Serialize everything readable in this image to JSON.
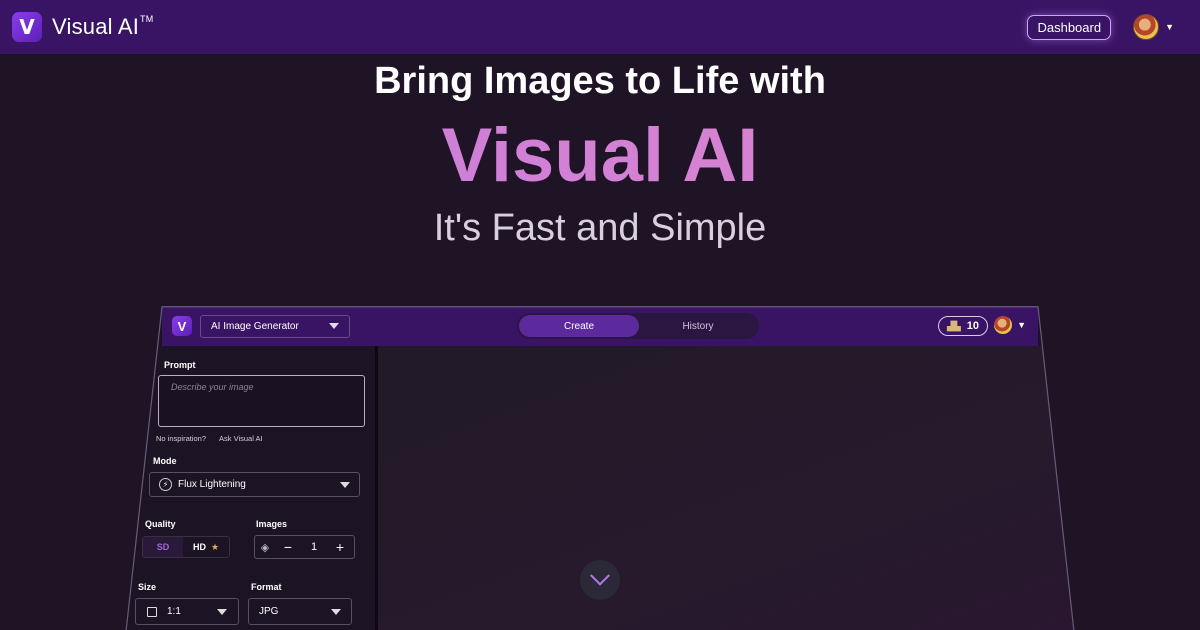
{
  "nav": {
    "logo_letter": "V",
    "brand": "Visual AI",
    "trademark": "TM",
    "dashboard_label": "Dashboard"
  },
  "hero": {
    "line1": "Bring Images to Life with",
    "line2": "Visual AI",
    "line3": "It's Fast and Simple"
  },
  "app": {
    "logo_letter": "V",
    "generator_select": "AI Image Generator",
    "tabs": [
      {
        "label": "Create",
        "active": true
      },
      {
        "label": "History",
        "active": false
      }
    ],
    "credits": "10",
    "prompt_label": "Prompt",
    "prompt_placeholder": "Describe your image",
    "no_inspiration": "No inspiration?",
    "ask_link": "Ask Visual AI",
    "mode_label": "Mode",
    "mode_value": "Flux Lightening",
    "quality_label": "Quality",
    "quality_sd": "SD",
    "quality_hd": "HD",
    "images_label": "Images",
    "images_count": "1",
    "size_label": "Size",
    "size_value": "1:1",
    "format_label": "Format",
    "format_value": "JPG"
  },
  "colors": {
    "nav_bg": "#3a1464",
    "page_bg": "#1e1426",
    "accent_gradient_start": "#c27ce0",
    "accent_gradient_end": "#e386c8",
    "active_tab": "#5d2a9e"
  }
}
